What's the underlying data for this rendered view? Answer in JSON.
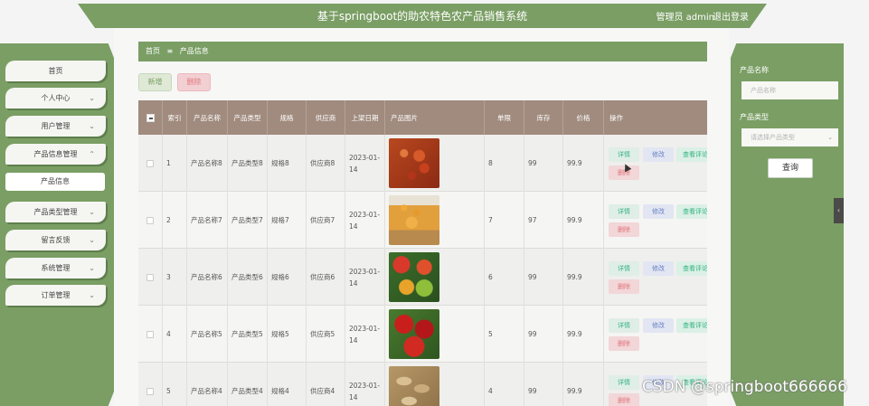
{
  "header": {
    "title": "基于springboot的助农特色农产品销售系统",
    "user_label": "管理员 admin",
    "logout_label": "退出登录"
  },
  "sidebar": {
    "items": [
      {
        "label": "首页",
        "has_chevron": false
      },
      {
        "label": "个人中心",
        "has_chevron": true
      },
      {
        "label": "用户管理",
        "has_chevron": true
      },
      {
        "label": "产品信息管理",
        "has_chevron": true,
        "expanded": true
      },
      {
        "label": "产品信息",
        "sub": true
      },
      {
        "label": "产品类型管理",
        "has_chevron": true
      },
      {
        "label": "留言反馈",
        "has_chevron": true
      },
      {
        "label": "系统管理",
        "has_chevron": true
      },
      {
        "label": "订单管理",
        "has_chevron": true
      }
    ]
  },
  "breadcrumb": {
    "home": "首页",
    "separator": "≡",
    "current": "产品信息"
  },
  "toolbar": {
    "add_label": "新增",
    "delete_label": "删除"
  },
  "table": {
    "headers": [
      "索引",
      "产品名称",
      "产品类型",
      "规格",
      "供应商",
      "上架日期",
      "产品图片",
      "单限",
      "库存",
      "价格",
      "操作"
    ],
    "rows": [
      {
        "index": "1",
        "name": "产品名称8",
        "type": "产品类型8",
        "spec": "规格8",
        "supplier": "供应商8",
        "date": "2023-01-14",
        "image": "chili-flakes",
        "limit": "8",
        "stock": "99",
        "price": "99.9"
      },
      {
        "index": "2",
        "name": "产品名称7",
        "type": "产品类型7",
        "spec": "规格7",
        "supplier": "供应商7",
        "date": "2023-01-14",
        "image": "corn-basket",
        "limit": "7",
        "stock": "97",
        "price": "99.9"
      },
      {
        "index": "3",
        "name": "产品名称6",
        "type": "产品类型6",
        "spec": "规格6",
        "supplier": "供应商6",
        "date": "2023-01-14",
        "image": "tomatoes-mixed",
        "limit": "6",
        "stock": "99",
        "price": "99.9"
      },
      {
        "index": "4",
        "name": "产品名称5",
        "type": "产品类型5",
        "spec": "规格5",
        "supplier": "供应商5",
        "date": "2023-01-14",
        "image": "red-tomatoes",
        "limit": "5",
        "stock": "99",
        "price": "99.9"
      },
      {
        "index": "5",
        "name": "产品名称4",
        "type": "产品类型4",
        "spec": "规格4",
        "supplier": "供应商4",
        "date": "2023-01-14",
        "image": "peanuts",
        "limit": "4",
        "stock": "99",
        "price": "99.9"
      }
    ],
    "actions": {
      "detail": "详情",
      "edit": "修改",
      "review": "查看评论",
      "remove": "删除"
    }
  },
  "search_panel": {
    "name_label": "产品名称",
    "name_placeholder": "产品名称",
    "type_label": "产品类型",
    "type_placeholder": "请选择产品类型",
    "search_label": "查询"
  },
  "watermark": "CSDN @springboot666666",
  "colors": {
    "primary": "#7a9e64",
    "table_header": "#a08b7e",
    "danger": "#e07980"
  }
}
